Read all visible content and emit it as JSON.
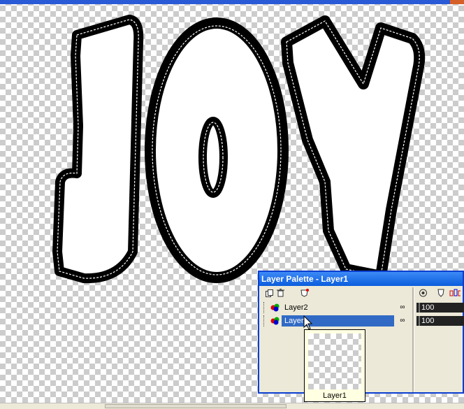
{
  "palette": {
    "title": "Layer Palette - Layer1",
    "layers": [
      {
        "name": "Layer2",
        "opacity": "100",
        "visible": true,
        "selected": false
      },
      {
        "name": "Layer1",
        "opacity": "100",
        "visible": true,
        "selected": true
      }
    ],
    "toolbar_icons": [
      "new-layer-icon",
      "delete-layer-icon",
      "layer-properties-icon"
    ],
    "column_icons": [
      "visibility-column-icon",
      "mask-column-icon",
      "link-column-icon"
    ]
  },
  "tooltip": {
    "label": "Layer1"
  },
  "colors": {
    "accent": "#0a5ddc",
    "selection": "#316ac5",
    "panel": "#ece9d8"
  }
}
